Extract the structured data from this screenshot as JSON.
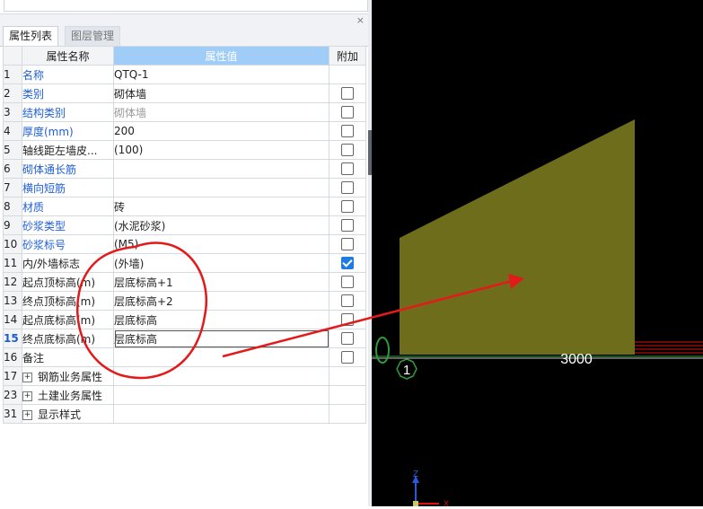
{
  "panel": {
    "close_label": "×",
    "tabs": [
      {
        "label": "属性列表",
        "active": true
      },
      {
        "label": "图层管理",
        "active": false
      }
    ],
    "headers": {
      "name": "属性名称",
      "value": "属性值",
      "extra": "附加"
    },
    "rows": [
      {
        "num": "1",
        "name": "名称",
        "value": "QTQ-1",
        "blue": true,
        "check": "none"
      },
      {
        "num": "2",
        "name": "类别",
        "value": "砌体墙",
        "blue": true,
        "check": "unchecked"
      },
      {
        "num": "3",
        "name": "结构类别",
        "value": "砌体墙",
        "blue": true,
        "value_gray": true,
        "check": "unchecked"
      },
      {
        "num": "4",
        "name": "厚度(mm)",
        "value": "200",
        "blue": true,
        "check": "unchecked"
      },
      {
        "num": "5",
        "name": "轴线距左墙皮...",
        "value": "(100)",
        "blue": false,
        "check": "unchecked"
      },
      {
        "num": "6",
        "name": "砌体通长筋",
        "value": "",
        "blue": true,
        "check": "unchecked"
      },
      {
        "num": "7",
        "name": "横向短筋",
        "value": "",
        "blue": true,
        "check": "unchecked"
      },
      {
        "num": "8",
        "name": "材质",
        "value": "砖",
        "blue": true,
        "check": "unchecked"
      },
      {
        "num": "9",
        "name": "砂浆类型",
        "value": "(水泥砂浆)",
        "blue": true,
        "check": "unchecked"
      },
      {
        "num": "10",
        "name": "砂浆标号",
        "value": "(M5)",
        "blue": true,
        "check": "unchecked"
      },
      {
        "num": "11",
        "name": "内/外墙标志",
        "value": "(外墙)",
        "blue": false,
        "check": "checked"
      },
      {
        "num": "12",
        "name": "起点顶标高(m)",
        "value": "层底标高+1",
        "blue": false,
        "check": "unchecked"
      },
      {
        "num": "13",
        "name": "终点顶标高(m)",
        "value": "层底标高+2",
        "blue": false,
        "check": "unchecked"
      },
      {
        "num": "14",
        "name": "起点底标高(m)",
        "value": "层底标高",
        "blue": false,
        "check": "unchecked"
      },
      {
        "num": "15",
        "name": "终点底标高(m)",
        "value": "层底标高",
        "blue": false,
        "check": "unchecked",
        "selected": true
      },
      {
        "num": "16",
        "name": "备注",
        "value": "",
        "blue": false,
        "check": "unchecked"
      }
    ],
    "groups": [
      {
        "num": "17",
        "label": "钢筋业务属性"
      },
      {
        "num": "23",
        "label": "土建业务属性"
      },
      {
        "num": "31",
        "label": "显示样式"
      }
    ]
  },
  "canvas": {
    "dimension_label": "3000",
    "axis_marker": "1",
    "axis_z": "Z",
    "axis_x": "X",
    "wall_color": "#6e6d1c",
    "annotation_color": "#e31a1a"
  }
}
